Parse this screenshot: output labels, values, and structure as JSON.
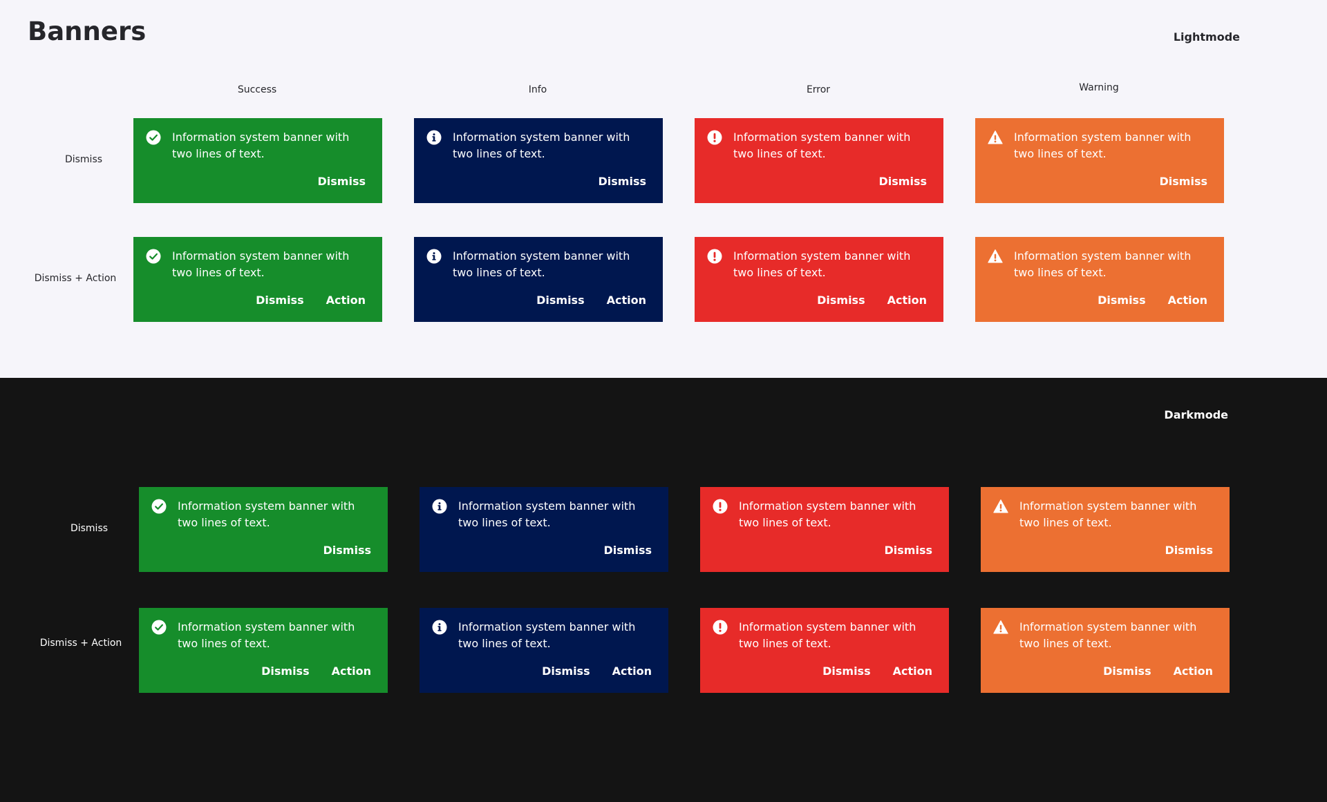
{
  "page": {
    "title": "Banners"
  },
  "modes": {
    "light": "Lightmode",
    "dark": "Darkmode"
  },
  "columns": [
    "Success",
    "Info",
    "Error",
    "Warning"
  ],
  "rows": [
    "Dismiss",
    "Dismiss + Action"
  ],
  "banner": {
    "text": "Information system banner with two lines of text.",
    "dismiss": "Dismiss",
    "action": "Action"
  },
  "variants": [
    {
      "type": "success",
      "icon": "check-circle-icon",
      "color": "#168d2b"
    },
    {
      "type": "info",
      "icon": "info-circle-icon",
      "color": "#00174f"
    },
    {
      "type": "error",
      "icon": "exclamation-circle-icon",
      "color": "#e72b29"
    },
    {
      "type": "warning",
      "icon": "warning-triangle-icon",
      "color": "#ec7032"
    }
  ],
  "colors": {
    "light_background": "#f6f5fa",
    "dark_background": "#141414",
    "text_dark": "#26262b",
    "text_light": "#ffffff"
  }
}
